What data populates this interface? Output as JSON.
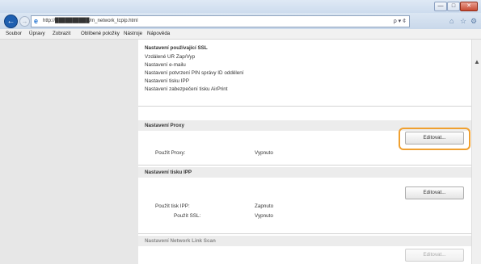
{
  "window": {
    "minimize": "—",
    "maximize": "□",
    "close": "✕"
  },
  "nav": {
    "back": "←",
    "forward": "→",
    "url": "http://██████████/m_network_tcpip.html",
    "addr_controls": "ρ ▾ ¢"
  },
  "menu": {
    "items": [
      "Soubor",
      "Úpravy",
      "Zobrazit",
      "Oblíbené položky",
      "Nástroje",
      "Nápověda"
    ]
  },
  "settings_list": {
    "header": "Nastavení používající SSL",
    "items": [
      "Vzdálené UR Zap/Vyp",
      "Nastavení e-mailu",
      "Nastavení potvrzení PIN správy ID oddělení",
      "Nastavení tisku IPP",
      "Nastavení zabezpečení tisku AirPrint"
    ]
  },
  "proxy": {
    "title": "Nastavení Proxy",
    "edit_label": "Editovat...",
    "use_proxy_label": "Použít Proxy:",
    "use_proxy_value": "Vypnuto"
  },
  "ipp": {
    "title": "Nastavení tisku IPP",
    "edit_label": "Editovat...",
    "use_ipp_label": "Použít tisk IPP:",
    "use_ipp_value": "Zapnuto",
    "use_ssl_label": "Použít SSL:",
    "use_ssl_value": "Vypnuto"
  },
  "scan": {
    "title": "Nastavení Network Link Scan",
    "edit_label": "Editovat..."
  },
  "colors": {
    "highlight": "#f0a030",
    "section_bg": "#ececec"
  }
}
